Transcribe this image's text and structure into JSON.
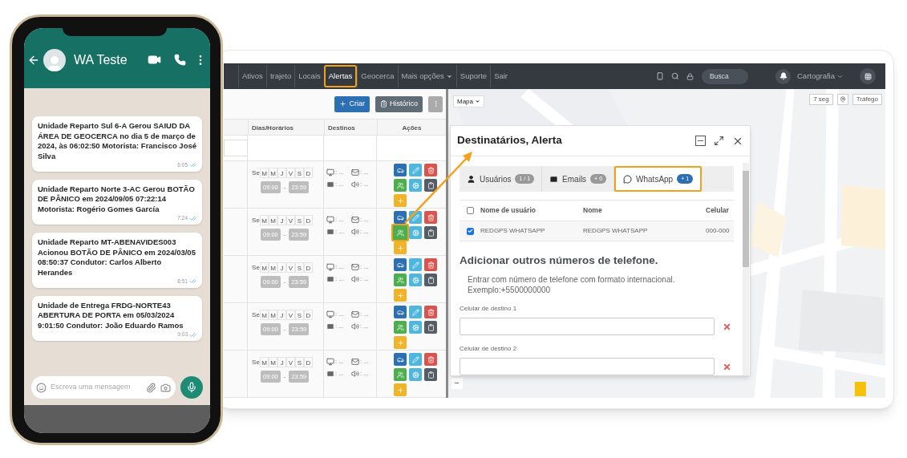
{
  "phone": {
    "chat_title": "WA Teste",
    "messages": [
      {
        "text": "Unidade Reparto Sul 6-A Gerou SAIUD DA ÁREA DE GEOCERCA no dia 5 de março de 2024, às 06:02:50 Motorista:  Francisco José Silva",
        "time": "6:05"
      },
      {
        "text": "Unidade Reparto Norte 3-AC Gerou BOTÃO DE PÂNICO em 2024/09/05 07:22:14 Motorista: Rogério Gomes García",
        "time": "7:24"
      },
      {
        "text": "Unidade Reparto MT-ABENAVIDES003 Acionou BOTÃO DE PÂNICO em 2024/03/05 08:50:37 Condutor: Carlos Alberto Herandes",
        "time": "8:51"
      },
      {
        "text": "Unidade de Entrega FRDG-NORTE43 ABERTURA DE PORTA em 05/03/2024 9:01:50 Condutor: João Eduardo  Ramos",
        "time": "9:03"
      }
    ],
    "composer": {
      "placeholder": "Escreva uma mensagem"
    }
  },
  "app": {
    "nav": [
      {
        "label": "Ativos",
        "selected": false,
        "highlighted": false,
        "dropdown": false
      },
      {
        "label": "trajeto",
        "selected": false,
        "highlighted": false,
        "dropdown": false
      },
      {
        "label": "Locais",
        "selected": false,
        "highlighted": false,
        "dropdown": false
      },
      {
        "label": "Alertas",
        "selected": true,
        "highlighted": true,
        "dropdown": false
      },
      {
        "label": "Geocerca",
        "selected": false,
        "highlighted": false,
        "dropdown": false
      },
      {
        "label": "Mais opções",
        "selected": false,
        "highlighted": false,
        "dropdown": true
      },
      {
        "label": "Suporte",
        "selected": false,
        "highlighted": false,
        "dropdown": false
      },
      {
        "label": "Sair",
        "selected": false,
        "highlighted": false,
        "dropdown": false
      }
    ],
    "search": {
      "placeholder": "Busca"
    },
    "map_menu": "Cartografia",
    "toolbar": {
      "create": "Criar",
      "history": "Histórico"
    },
    "table": {
      "columns": [
        "Dias/Horários",
        "Destinos",
        "Ações"
      ],
      "rows": [
        {
          "days": [
            "Se",
            "M",
            "M",
            "J",
            "V",
            "S",
            "D"
          ],
          "start": "09:00",
          "separator": "-",
          "end": "23:59",
          "destinations": [
            ": ...",
            ": ...",
            ": ...",
            ": ..."
          ],
          "recipients_highlighted": false
        },
        {
          "days": [
            "Se",
            "M",
            "M",
            "J",
            "V",
            "S",
            "D"
          ],
          "start": "09:00",
          "separator": "-",
          "end": "23:59",
          "destinations": [
            ": ...",
            ": ...",
            ": ...",
            ": ..."
          ],
          "recipients_highlighted": true
        },
        {
          "days": [
            "Se",
            "M",
            "M",
            "J",
            "V",
            "S",
            "D"
          ],
          "start": "09:00",
          "separator": "-",
          "end": "23:59",
          "destinations": [
            ": ...",
            ": ...",
            ": ...",
            ": ..."
          ],
          "recipients_highlighted": false
        },
        {
          "days": [
            "Se",
            "M",
            "M",
            "J",
            "V",
            "S",
            "D"
          ],
          "start": "09:00",
          "separator": "-",
          "end": "23:59",
          "destinations": [
            ": ...",
            ": ...",
            ": ...",
            ": ..."
          ],
          "recipients_highlighted": false
        },
        {
          "days": [
            "Se",
            "M",
            "M",
            "J",
            "V",
            "S",
            "D"
          ],
          "start": "09:00",
          "separator": "-",
          "end": "23:59",
          "destinations": [
            ": ...",
            ": ...",
            ": ...",
            ": ..."
          ],
          "recipients_highlighted": false
        }
      ]
    },
    "map": {
      "layer_menu": "Mapa",
      "refresh": "7 seg",
      "traffic": "Tráfego",
      "zoom_out": "−"
    },
    "dialog": {
      "title": "Destinatários, Alerta",
      "tabs": [
        {
          "kind": "users",
          "label": "Usuários",
          "count": "1 / 1",
          "selected": false,
          "highlighted": false
        },
        {
          "kind": "emails",
          "label": "Emails",
          "count": "+ 0",
          "selected": false,
          "highlighted": false
        },
        {
          "kind": "whatsapp",
          "label": "WhatsApp",
          "count": "+ 1",
          "selected": true,
          "highlighted": true
        }
      ],
      "columns": [
        "Nome de usuário",
        "Nome",
        "Celular"
      ],
      "select_all": false,
      "rows": [
        {
          "checked": true,
          "cells": [
            "REDGPS WHATSAPP",
            "REDGPS WHATSAPP",
            "000-000"
          ]
        }
      ],
      "heading": "Adicionar outros números de telefone.",
      "hint_lines": [
        "Entrar com número de telefone com formato internacional.",
        "Exemplo:+5500000000"
      ],
      "fields": [
        {
          "label": "Celular de destino 1"
        },
        {
          "label": "Celular de destino 2"
        }
      ]
    }
  }
}
